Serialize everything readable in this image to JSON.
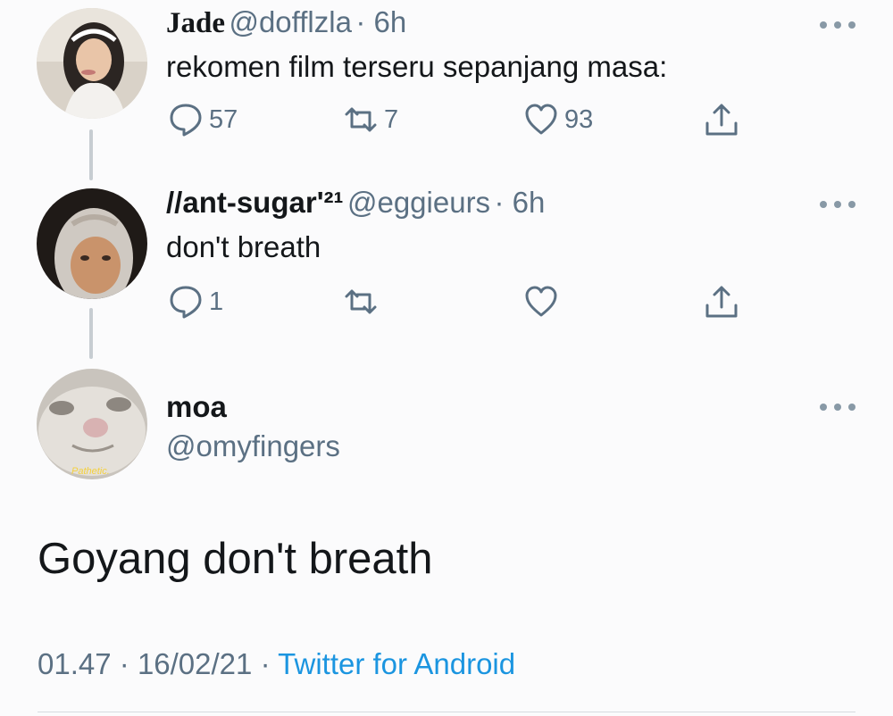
{
  "tweets": [
    {
      "name": "Jade",
      "handle": "@dofflzla",
      "time": "· 6h",
      "text": "rekomen film terseru sepanjang masa:",
      "reply_count": "57",
      "retweet_count": "7",
      "like_count": "93",
      "avatar_icon": "avatar-photo-girl"
    },
    {
      "name": "//ant-sugar'²¹",
      "handle": "@eggieurs",
      "time": "· 6h",
      "text": "don't breath",
      "reply_count": "1",
      "retweet_count": "",
      "like_count": "",
      "avatar_icon": "avatar-photo-hijab"
    }
  ],
  "main_tweet": {
    "name": "moa",
    "handle": "@omyfingers",
    "avatar_caption": "Pathetic.",
    "avatar_icon": "avatar-photo-cat",
    "text": "Goyang don't breath",
    "time": "01.47",
    "date": "16/02/21",
    "source": "Twitter for Android"
  },
  "colors": {
    "text": "#14171a",
    "secondary": "#5b7083",
    "link": "#1b95e0",
    "thread_line": "#c7cdd2"
  }
}
